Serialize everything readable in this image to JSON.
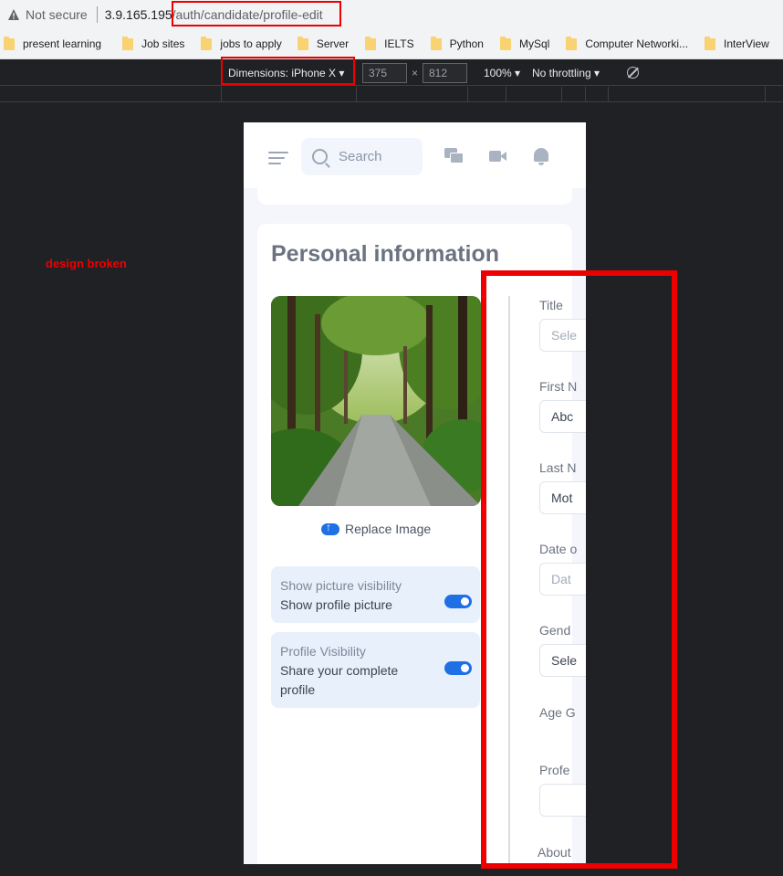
{
  "browser": {
    "security_label": "Not secure",
    "url_host": "3.9.165.195",
    "url_path": "/auth/candidate/profile-edit",
    "bookmarks": [
      "present learning",
      "Job sites",
      "jobs to apply",
      "Server",
      "IELTS",
      "Python",
      "MySql",
      "Computer Networki...",
      "InterView"
    ]
  },
  "devtools": {
    "dimensions_label": "Dimensions: iPhone X ▾",
    "width": "375",
    "height": "812",
    "zoom": "100% ▾",
    "throttling": "No throttling ▾"
  },
  "annotation": "design broken",
  "app": {
    "search_placeholder": "Search",
    "section_title": "Personal information",
    "replace_image": "Replace Image",
    "picture_visibility": {
      "heading": "Show picture visibility",
      "text": "Show profile picture",
      "enabled": true
    },
    "profile_visibility": {
      "heading": "Profile Visibility",
      "text": "Share your complete profile",
      "enabled": true
    },
    "form": {
      "title_label": "Title",
      "title_value": "Sele",
      "first_name_label": "First N",
      "first_name_value": "Abc",
      "last_name_label": "Last N",
      "last_name_value": "Mot",
      "dob_label": "Date o",
      "dob_placeholder": "Dat",
      "gender_label": "Gend",
      "gender_value": "Sele",
      "age_group_label": "Age G",
      "profession_label": "Profe",
      "about_label": "About"
    }
  }
}
